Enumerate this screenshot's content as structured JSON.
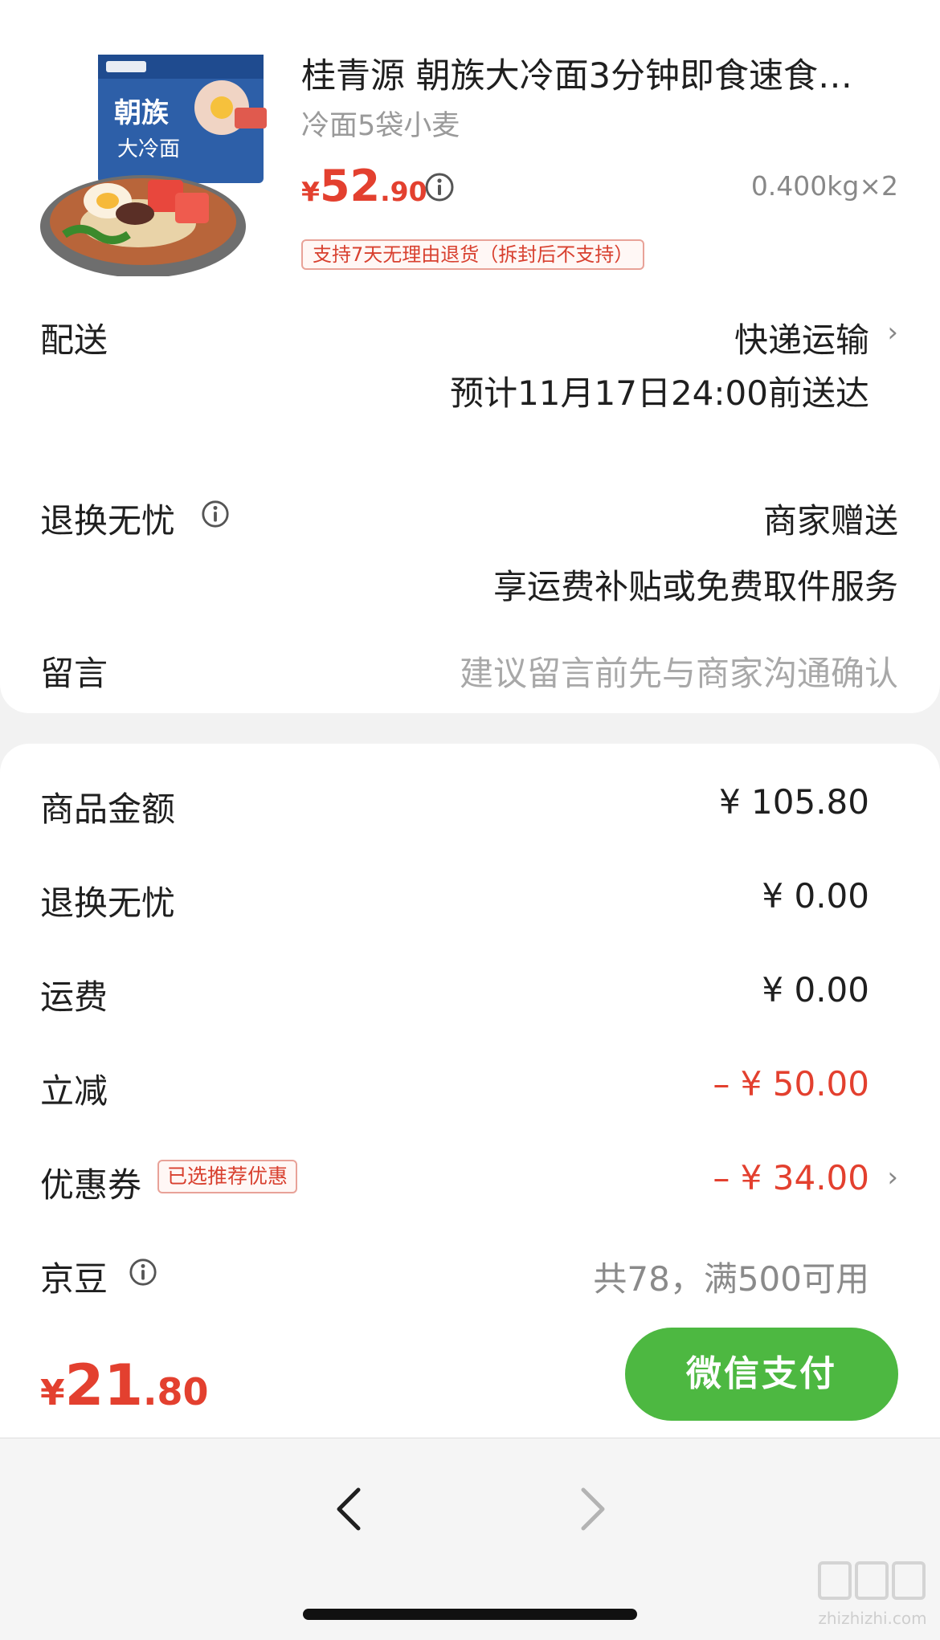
{
  "product": {
    "title": "桂青源 朝族大冷面3分钟即食速食…",
    "subtitle": "冷面5袋小麦",
    "price_currency": "¥",
    "price_int": "52",
    "price_dec": ".90",
    "quantity": "0.400kg×2",
    "return_badge": "支持7天无理由退货（拆封后不支持）",
    "thumbnail_icon": "cold-noodle-product-image"
  },
  "delivery": {
    "label": "配送",
    "method": "快递运输",
    "eta": "预计11月17日24:00前送达"
  },
  "exchange_service": {
    "label": "退换无忧",
    "value": "商家赠送",
    "note": "享运费补贴或免费取件服务"
  },
  "message": {
    "label": "留言",
    "placeholder": "建议留言前先与商家沟通确认"
  },
  "summary": {
    "goods_amount_label": "商品金额",
    "goods_amount": "¥ 105.80",
    "exchange_label": "退换无忧",
    "exchange_amount": "¥ 0.00",
    "shipping_label": "运费",
    "shipping_amount": "¥ 0.00",
    "discount_label": "立减",
    "discount_amount": "– ¥ 50.00",
    "coupon_label": "优惠券",
    "coupon_tag": "已选推荐优惠",
    "coupon_amount": "– ¥ 34.00",
    "jingdou_label": "京豆",
    "jingdou_value": "共78，满500可用"
  },
  "checkout": {
    "total_currency": "¥",
    "total_int": "21",
    "total_dec": ".80",
    "pay_button": "微信支付"
  },
  "watermark": {
    "site": "zhizhizhi.com",
    "logo_text": "值值值"
  },
  "colors": {
    "accent_red": "#e3402f",
    "pay_green": "#4db841",
    "muted_gray": "#a8a8a8"
  }
}
